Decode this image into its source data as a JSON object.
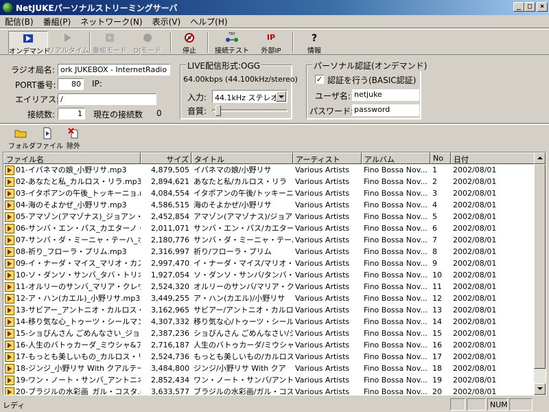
{
  "window": {
    "title": "NetJUKEパーソナルストリーミングサーバ",
    "minimize": "_",
    "maximize": "□",
    "close": "×"
  },
  "menu": [
    "配信(B)",
    "番組(P)",
    "ネットワーク(N)",
    "表示(V)",
    "ヘルプ(H)"
  ],
  "toolbar": {
    "ondemand": "オンデマンド",
    "realtime": "リアルタイム",
    "program_mode": "番組モード",
    "dj_mode": "DJモード",
    "stop": "停止",
    "connect_test": "接続テスト",
    "external_ip": "外部IP",
    "info": "情報"
  },
  "settings": {
    "station_label": "ラジオ局名:",
    "station_value": "ork JUKEBOX - InternetRadio",
    "port_label": "PORT番号:",
    "port_value": "80",
    "ip_label": "IP:",
    "alias_label": "エイリアス:",
    "alias_value": "/",
    "connections_label": "接続数:",
    "connections_value": "1",
    "current_connections_label": "現在の接続数",
    "current_connections_value": "0"
  },
  "live": {
    "title": "LIVE配信形式:OGG",
    "bitrate": "64.00kbps (44.100kHz/stereo)",
    "input_label": "入力:",
    "input_value": "44.1kHz ステレオ",
    "quality_label": "音質:",
    "quality_level": 0.05
  },
  "auth": {
    "title": "パーソナル認証(オンデマンド)",
    "checkbox_label": "認証を行う(BASIC認証)",
    "checkbox_mark": "✓",
    "checked": true,
    "username_label": "ユーザ名:",
    "username_value": "netjuke",
    "password_label": "パスワード:",
    "password_value": "password"
  },
  "filetools": {
    "folder": "フォルダ",
    "file": "ファイル",
    "remove": "除外"
  },
  "list": {
    "headers": [
      "ファイル名",
      "サイズ",
      "タイトル",
      "アーティスト",
      "アルバム",
      "No",
      "日付"
    ],
    "rows": [
      [
        "01-イパネマの娘_小野リサ.mp3",
        "4,879,505",
        "イパネマの娘/小野リサ",
        "Various Artists",
        "Fino Bossa Nov...",
        "1",
        "2002/08/01"
      ],
      [
        "02-あなたと私_カルロス・リラ.mp3",
        "2,894,621",
        "あなたと私/カルロス・リラ",
        "Various Artists",
        "Fino Bossa Nov...",
        "2",
        "2002/08/01"
      ],
      [
        "03-イタポアンの午後_トッキーニョ.mp3",
        "4,084,554",
        "イタポアンの午後/トッキーニョ",
        "Various Artists",
        "Fino Bossa Nov...",
        "3",
        "2002/08/01"
      ],
      [
        "04-海のそよかぜ_小野リサ.mp3",
        "4,586,515",
        "海のそよかぜ/小野リサ",
        "Various Artists",
        "Fino Bossa Nov...",
        "4",
        "2002/08/01"
      ],
      [
        "05-アマゾン(アマゾナス)_ジョアン・ド...",
        "2,452,854",
        "アマゾン(アマゾナス)/ジョア",
        "Various Artists",
        "Fino Bossa Nov...",
        "5",
        "2002/08/01"
      ],
      [
        "06-サンバ・エン・パス_カエターノ・ヴェ...",
        "2,011,071",
        "サンバ・エン・パス/カエターノ",
        "Various Artists",
        "Fino Bossa Nov...",
        "6",
        "2002/08/01"
      ],
      [
        "07-サンバ・ダ・ミーニャ・テーハ_ホジー...",
        "2,180,776",
        "サンバ・ダ・ミーニャ・テーハ/",
        "Various Artists",
        "Fino Bossa Nov...",
        "7",
        "2002/08/01"
      ],
      [
        "08-祈り_フローラ・プリム.mp3",
        "2,316,997",
        "祈り/フローラ・プリム",
        "Various Artists",
        "Fino Bossa Nov...",
        "8",
        "2002/08/01"
      ],
      [
        "09-イ・ナーダ・マイス_マリオ・カストロ・...",
        "2,997,470",
        "イ・ナーダ・マイス/マリオ・カ",
        "Various Artists",
        "Fino Bossa Nov...",
        "9",
        "2002/08/01"
      ],
      [
        "10-ソ・ダンソ・サンバ_タバ・トリオ.m...",
        "1,927,054",
        "ソ・ダンソ・サンバ/タンバ・ト",
        "Various Artists",
        "Fino Bossa Nov...",
        "10",
        "2002/08/01"
      ],
      [
        "11-オルリーのサンバ_マリア・クレウー...",
        "2,524,320",
        "オルリーのサンバ/マリア・クレ",
        "Various Artists",
        "Fino Bossa Nov...",
        "11",
        "2002/08/01"
      ],
      [
        "12-ア・ハン(カエル)_小野リサ.mp3",
        "3,449,255",
        "ア・ハン(カエル)/小野リサ",
        "Various Artists",
        "Fino Bossa Nov...",
        "12",
        "2002/08/01"
      ],
      [
        "13-サビアー_アントニオ・カルロス・ジョ...",
        "3,162,965",
        "サビアー/アントニオ・カルロス",
        "Various Artists",
        "Fino Bossa Nov...",
        "13",
        "2002/08/01"
      ],
      [
        "14-移り気な心_トゥーツ・シールマン...",
        "4,307,332",
        "移り気な心/トゥーツ・シール...",
        "Various Artists",
        "Fino Bossa Nov...",
        "14",
        "2002/08/01"
      ],
      [
        "15-ショびんさん ごめんなさい_ジョニ...",
        "2,387,236",
        "ショびんさん ごめんなさい/ジョ",
        "Various Artists",
        "Fino Bossa Nov...",
        "15",
        "2002/08/01"
      ],
      [
        "16-人生のバトゥカーダ_ミウシャ&ア...",
        "2,716,187",
        "人生のバトゥカーダ/ミウシャ...",
        "Various Artists",
        "Fino Bossa Nov...",
        "16",
        "2002/08/01"
      ],
      [
        "17-もっとも美しいもの_カルロス・リラ...",
        "2,524,736",
        "もっとも美しいもの/カルロス・",
        "Various Artists",
        "Fino Bossa Nov...",
        "17",
        "2002/08/01"
      ],
      [
        "18-ジンジ_小野リサ With クアルテー...",
        "3,484,800",
        "ジンジ/小野リサ With クア",
        "Various Artists",
        "Fino Bossa Nov...",
        "18",
        "2002/08/01"
      ],
      [
        "19-ワン・ノート・サンバ_アントニオ・カ...",
        "2,852,434",
        "ワン・ノート・サンバ/アントニ",
        "Various Artists",
        "Fino Bossa Nov...",
        "19",
        "2002/08/01"
      ],
      [
        "20-ブラジルの水彩画_ガル・コスタ.m...",
        "3,633,577",
        "ブラジルの水彩画/ガル・コス...",
        "Various Artists",
        "Fino Bossa Nov...",
        "20",
        "2002/08/01"
      ]
    ]
  },
  "status": {
    "text": "レディ",
    "num": "NUM"
  }
}
